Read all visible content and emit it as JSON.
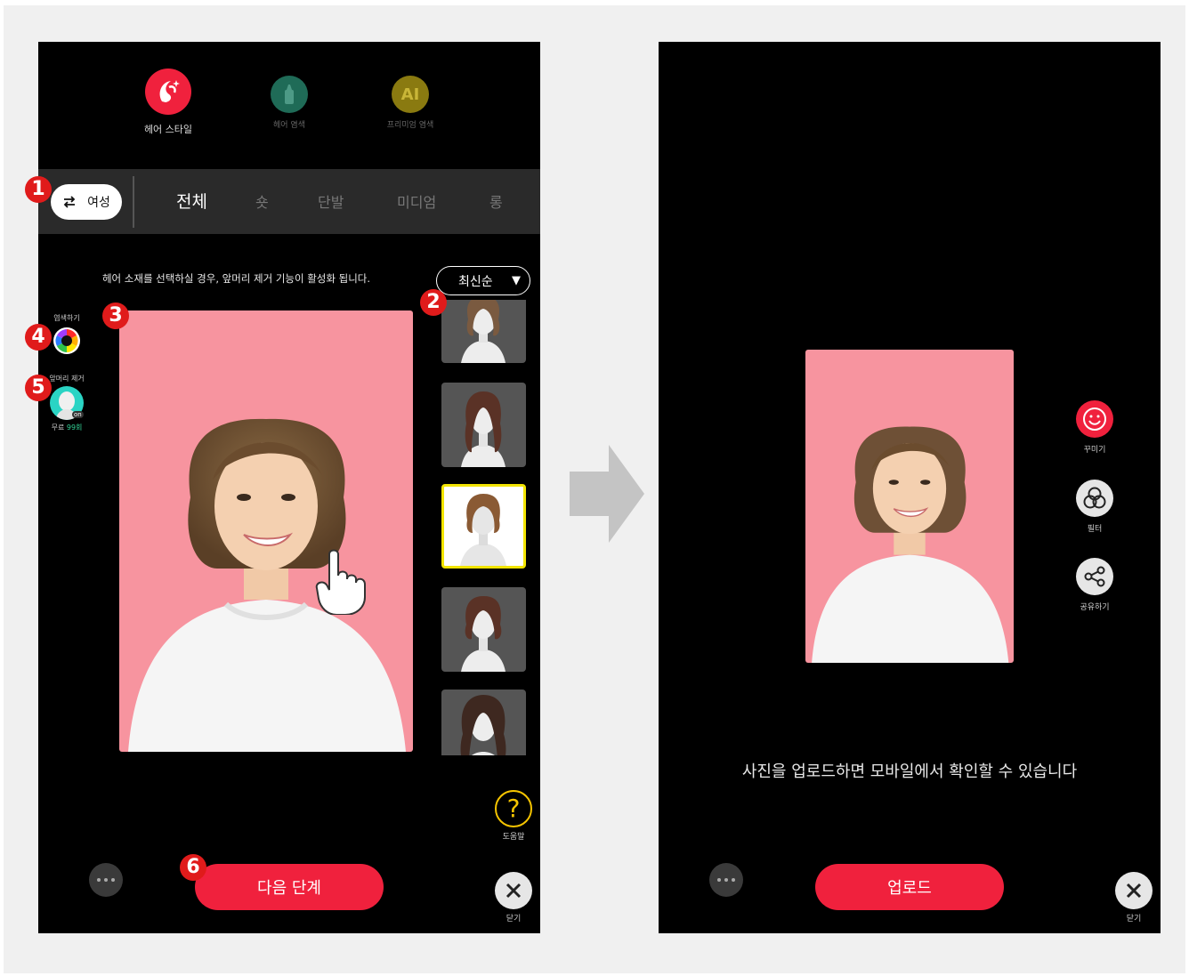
{
  "left_screen": {
    "top_icons": [
      {
        "label": "헤어 스타일",
        "icon": "hair-style-icon",
        "color": "#f0213d"
      },
      {
        "label": "헤어 염색",
        "icon": "hair-dye-icon",
        "color": "#1f6b57"
      },
      {
        "label": "프리미엄 염색",
        "icon": "ai-premium-icon",
        "icon_text": "AI",
        "color": "#8a7a10"
      }
    ],
    "gender_button": {
      "label": "여성",
      "icon": "swap-arrows-icon"
    },
    "tabs": [
      "전체",
      "숏",
      "단발",
      "미디엄",
      "롱"
    ],
    "active_tab": "전체",
    "notice": "헤어 소재를 선택하실 경우, 앞머리 제거 기능이 활성화 됩니다.",
    "sort": {
      "label": "최신순",
      "icon": "caret-down-icon"
    },
    "dye_tool": {
      "label": "염색하기",
      "icon": "color-wheel-icon"
    },
    "bang_tool": {
      "label": "앞머리 제거",
      "sub_prefix": "무료",
      "count": "99회",
      "badge": "on"
    },
    "next_button": "다음 단계",
    "help": {
      "symbol": "?",
      "label": "도움말"
    },
    "close": {
      "label": "닫기"
    },
    "markers": [
      "1",
      "2",
      "3",
      "4",
      "5",
      "6"
    ]
  },
  "right_screen": {
    "tools": [
      {
        "label": "꾸미기",
        "icon": "smile-icon",
        "color": "#f0213d"
      },
      {
        "label": "필터",
        "icon": "filter-circles-icon",
        "color": "#e6e6e6"
      },
      {
        "label": "공유하기",
        "icon": "share-icon",
        "color": "#e6e6e6"
      }
    ],
    "message": "사진을 업로드하면 모바일에서 확인할 수 있습니다",
    "upload_button": "업로드",
    "close": {
      "label": "닫기"
    }
  },
  "colors": {
    "accent": "#f0213d",
    "photo_bg": "#f7949f",
    "selected_border": "#f2e400",
    "marker": "#e01b1b"
  }
}
